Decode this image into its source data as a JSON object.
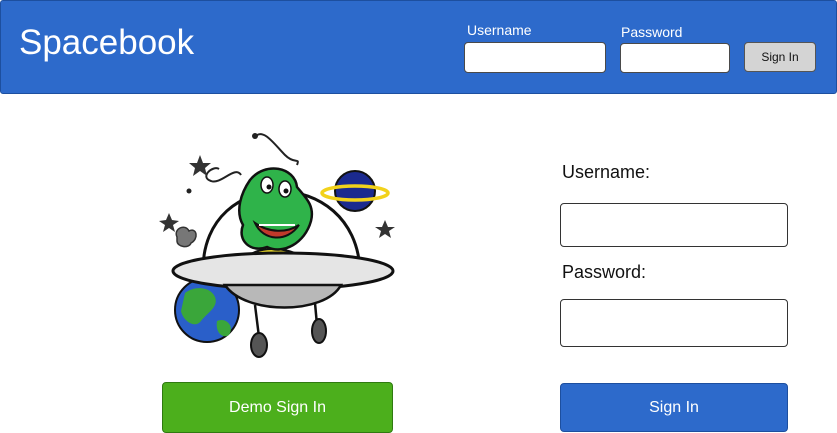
{
  "header": {
    "logo": "Spacebook",
    "username_label": "Username",
    "password_label": "Password",
    "username_value": "",
    "password_value": "",
    "signin_label": "Sign In"
  },
  "form": {
    "username_label": "Username:",
    "password_label": "Password:",
    "username_value": "",
    "password_value": "",
    "signin_label": "Sign In"
  },
  "demo": {
    "label": "Demo Sign In"
  },
  "colors": {
    "brand_blue": "#2d6acb",
    "demo_green": "#4caf1c",
    "alien_green": "#2fb34a",
    "planet_navy": "#1b2a8f",
    "planet_ring": "#f2d21b"
  },
  "illustration": {
    "icon": "alien-in-ufo-icon"
  }
}
